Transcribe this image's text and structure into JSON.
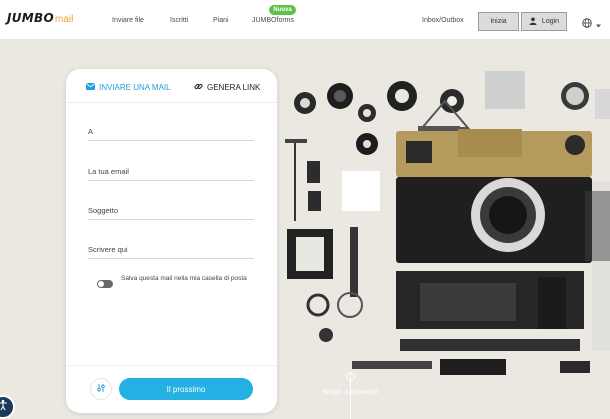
{
  "header": {
    "logo_main": "JUMBO",
    "logo_sub": "mail",
    "nav": [
      {
        "label": "Inviare file"
      },
      {
        "label": "Iscritti"
      },
      {
        "label": "Piani"
      },
      {
        "label": "JUMBOforms",
        "badge": "Nuova"
      }
    ],
    "inbox_label": "Inbox/Outbox",
    "start_label": "Inizia",
    "login_label": "Login",
    "language_icon": "globe-icon",
    "badge_color": "#5fc04a"
  },
  "form": {
    "tabs": [
      {
        "label": "INVIARE UNA MAIL",
        "icon": "envelope-icon",
        "active": true
      },
      {
        "label": "GENERA LINK",
        "icon": "link-icon",
        "active": false
      }
    ],
    "fields": [
      {
        "placeholder": "A"
      },
      {
        "placeholder": "La tua email"
      },
      {
        "placeholder": "Soggetto"
      },
      {
        "placeholder": "Scrivere qui"
      }
    ],
    "save_toggle_label": "Salva questa mail nella mia casella di posta",
    "save_toggle_on": false,
    "settings_icon": "sliders-icon",
    "next_label": "Il prossimo",
    "accent_color": "#24b0e3"
  },
  "footer": {
    "discover_label": "Scopri Jumbomail",
    "accessibility_icon": "accessibility-icon"
  }
}
